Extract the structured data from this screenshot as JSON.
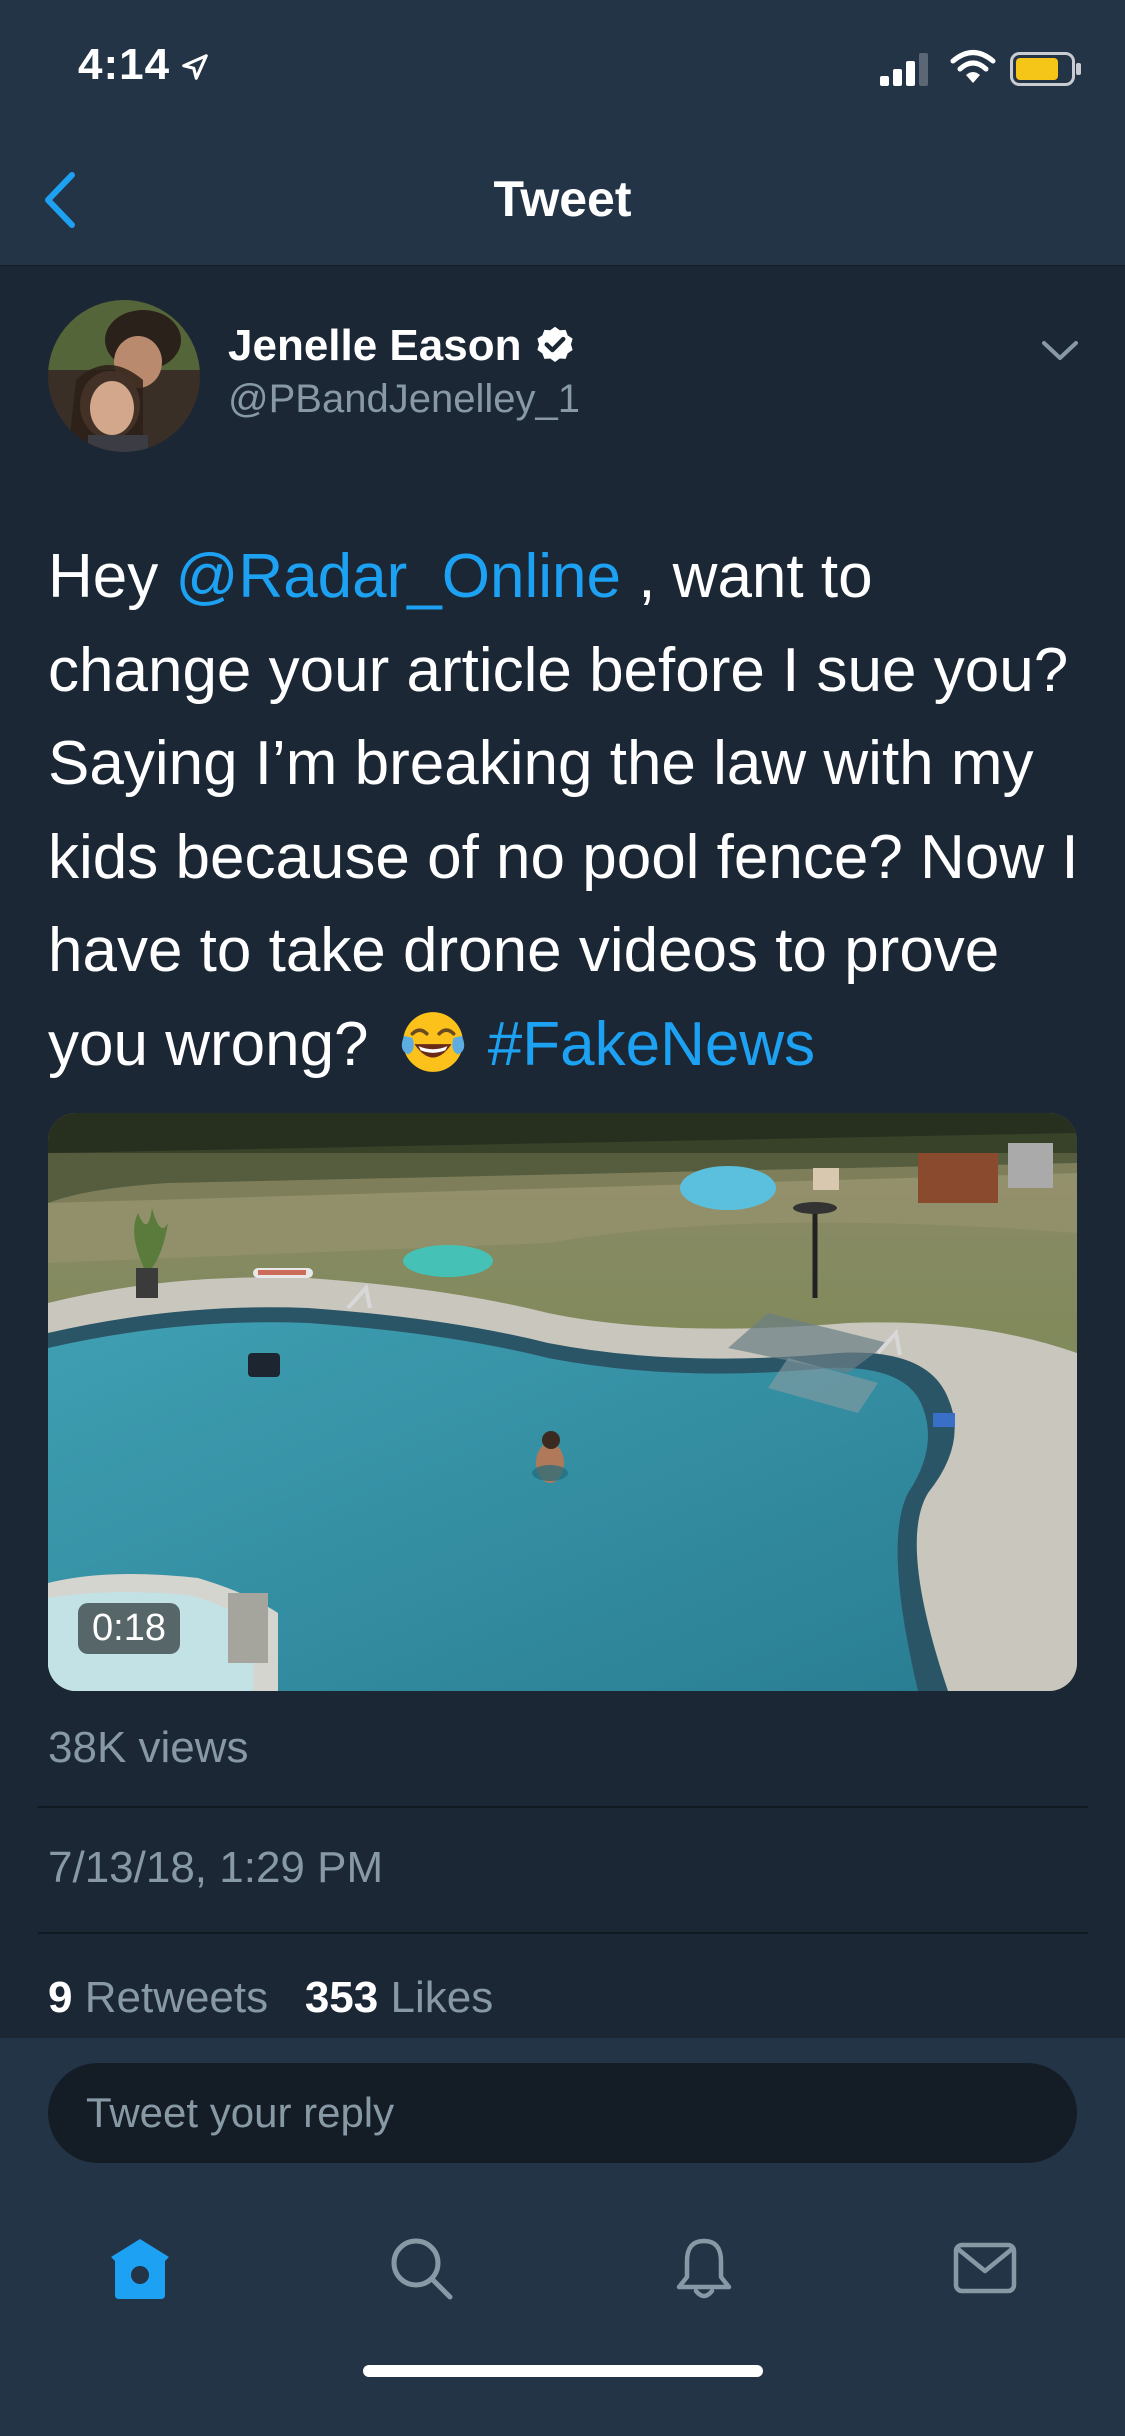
{
  "status_bar": {
    "time": "4:14",
    "icons": [
      "location-arrow-icon",
      "signal-icon",
      "wifi-icon",
      "battery-icon"
    ]
  },
  "nav": {
    "title": "Tweet",
    "back_icon": "chevron-left-icon"
  },
  "tweet": {
    "display_name": "Jenelle Eason",
    "verified": true,
    "handle": "@PBandJenelley_1",
    "text_parts": {
      "p1": "Hey ",
      "mention": "@Radar_Online",
      "p2": " , want to change your article before I sue you? Saying I’m breaking the law with my kids because of no pool fence? Now I have to take drone videos to prove you wrong? ",
      "hashtag": "#FakeNews"
    },
    "emoji": "face-with-tears-of-joy",
    "video_duration": "0:18",
    "views": "38K views",
    "timestamp": "7/13/18, 1:29 PM",
    "retweets_count": "9",
    "retweets_label": "Retweets",
    "likes_count": "353",
    "likes_label": "Likes"
  },
  "reply": {
    "placeholder": "Tweet your reply"
  },
  "tabbar": [
    "home-icon",
    "search-icon",
    "notifications-icon",
    "messages-icon"
  ],
  "colors": {
    "background": "#1b2735",
    "bars": "#243447",
    "accent": "#1da1f2",
    "secondary_text": "#8899a6"
  }
}
